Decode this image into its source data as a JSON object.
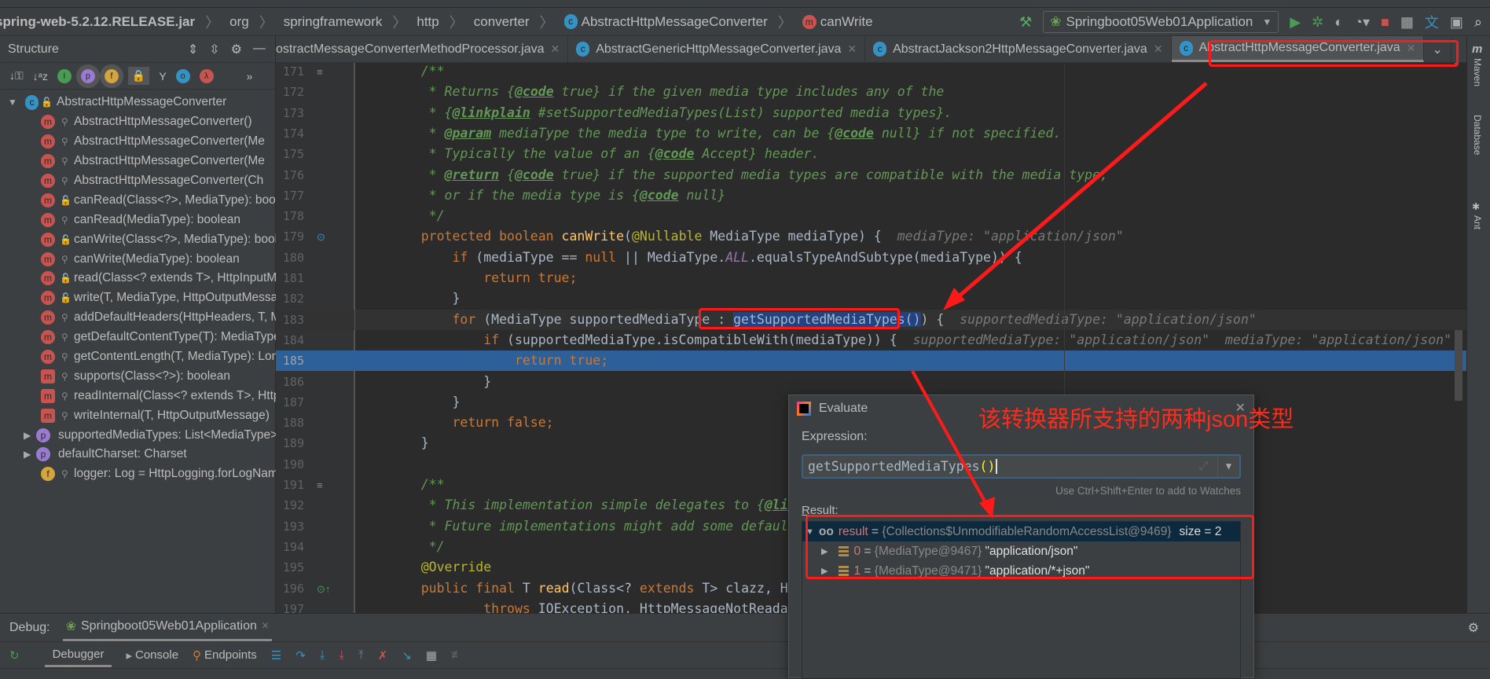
{
  "breadcrumb": [
    "spring-web-5.2.12.RELEASE.jar",
    "org",
    "springframework",
    "http",
    "converter",
    "AbstractHttpMessageConverter",
    "canWrite"
  ],
  "run_config": "Springboot05Web01Application",
  "structure": {
    "title": "Structure",
    "root": "AbstractHttpMessageConverter",
    "items": [
      {
        "icon": "method",
        "vis": "private",
        "label": "AbstractHttpMessageConverter()"
      },
      {
        "icon": "method",
        "vis": "private",
        "label": "AbstractHttpMessageConverter(Me"
      },
      {
        "icon": "method",
        "vis": "private",
        "label": "AbstractHttpMessageConverter(Me"
      },
      {
        "icon": "method",
        "vis": "private",
        "label": "AbstractHttpMessageConverter(Ch"
      },
      {
        "icon": "method",
        "vis": "public",
        "label": "canRead(Class<?>, MediaType): boolean"
      },
      {
        "icon": "method",
        "vis": "private",
        "label": "canRead(MediaType): boolean"
      },
      {
        "icon": "method",
        "vis": "public",
        "label": "canWrite(Class<?>, MediaType): boolean"
      },
      {
        "icon": "method",
        "vis": "private",
        "label": "canWrite(MediaType): boolean"
      },
      {
        "icon": "method",
        "vis": "public",
        "label": "read(Class<? extends T>, HttpInputMessage)"
      },
      {
        "icon": "method",
        "vis": "public",
        "label": "write(T, MediaType, HttpOutputMessage)"
      },
      {
        "icon": "method",
        "vis": "private",
        "label": "addDefaultHeaders(HttpHeaders, T, MediaType)"
      },
      {
        "icon": "method",
        "vis": "private",
        "label": "getDefaultContentType(T): MediaType"
      },
      {
        "icon": "method",
        "vis": "private",
        "label": "getContentLength(T, MediaType): Long"
      },
      {
        "icon": "abstract-method",
        "vis": "private",
        "label": "supports(Class<?>): boolean"
      },
      {
        "icon": "abstract-method",
        "vis": "private",
        "label": "readInternal(Class<? extends T>, HttpInputMessage)"
      },
      {
        "icon": "abstract-method",
        "vis": "private",
        "label": "writeInternal(T, HttpOutputMessage)"
      },
      {
        "icon": "property",
        "vis": "",
        "label": "supportedMediaTypes: List<MediaType>",
        "expandable": true
      },
      {
        "icon": "property",
        "vis": "",
        "label": "defaultCharset: Charset",
        "expandable": true
      },
      {
        "icon": "field",
        "vis": "private",
        "label": "logger: Log = HttpLogging.forLogName(getClass())"
      }
    ]
  },
  "tabs": [
    {
      "label": "ostractMessageConverterMethodProcessor.java",
      "active": false
    },
    {
      "label": "AbstractGenericHttpMessageConverter.java",
      "active": false
    },
    {
      "label": "AbstractJackson2HttpMessageConverter.java",
      "active": false
    },
    {
      "label": "AbstractHttpMessageConverter.java",
      "active": true
    }
  ],
  "right_tools": [
    "Maven",
    "Database",
    "Ant"
  ],
  "code": [
    {
      "n": "171",
      "t": [
        [
          "pl",
          "    "
        ],
        [
          "cm",
          "/**"
        ]
      ]
    },
    {
      "n": "172",
      "t": [
        [
          "cm",
          "     * Returns {"
        ],
        [
          "tag",
          "@code"
        ],
        [
          "cm",
          " true} if the given media type includes any of the"
        ]
      ]
    },
    {
      "n": "173",
      "t": [
        [
          "cm",
          "     * {"
        ],
        [
          "tag",
          "@linkplain"
        ],
        [
          "cm",
          " #setSupportedMediaTypes(List) supported media types}."
        ]
      ]
    },
    {
      "n": "174",
      "t": [
        [
          "cm",
          "     * "
        ],
        [
          "tag",
          "@param"
        ],
        [
          "cm",
          " mediaType the media type to write, can be {"
        ],
        [
          "tag",
          "@code"
        ],
        [
          "cm",
          " null} if not specified."
        ]
      ]
    },
    {
      "n": "175",
      "t": [
        [
          "cm",
          "     * Typically the value of an {"
        ],
        [
          "tag",
          "@code"
        ],
        [
          "cm",
          " Accept} header."
        ]
      ]
    },
    {
      "n": "176",
      "t": [
        [
          "cm",
          "     * "
        ],
        [
          "tag",
          "@return"
        ],
        [
          "cm",
          " {"
        ],
        [
          "tag",
          "@code"
        ],
        [
          "cm",
          " true} if the supported media types are compatible with the media type,"
        ]
      ]
    },
    {
      "n": "177",
      "t": [
        [
          "cm",
          "     * or if the media type is {"
        ],
        [
          "tag",
          "@code"
        ],
        [
          "cm",
          " null}"
        ]
      ]
    },
    {
      "n": "178",
      "t": [
        [
          "cm",
          "     */"
        ]
      ]
    },
    {
      "n": "179",
      "t": [
        [
          "kw",
          "    protected boolean "
        ],
        [
          "fn",
          "canWrite"
        ],
        [
          "pl",
          "("
        ],
        [
          "an",
          "@Nullable"
        ],
        [
          "pl",
          " MediaType mediaType) {  "
        ],
        [
          "hint",
          "mediaType: \"application/json\""
        ]
      ]
    },
    {
      "n": "180",
      "t": [
        [
          "kw",
          "        if "
        ],
        [
          "pl",
          "(mediaType == "
        ],
        [
          "kw",
          "null"
        ],
        [
          "pl",
          " || MediaType."
        ],
        [
          "st",
          "ALL"
        ],
        [
          "pl",
          ".equalsTypeAndSubtype(mediaType)) {"
        ]
      ]
    },
    {
      "n": "181",
      "t": [
        [
          "kw",
          "            return true"
        ],
        [
          "kw",
          ";"
        ]
      ]
    },
    {
      "n": "182",
      "t": [
        [
          "pl",
          "        }"
        ]
      ]
    },
    {
      "n": "183",
      "caret": true,
      "t": [
        [
          "kw",
          "        for "
        ],
        [
          "pl",
          "(MediaType supportedMediaType : "
        ],
        [
          "sel",
          "getSupportedMediaTypes()"
        ],
        [
          "pl",
          ") {  "
        ],
        [
          "hint",
          "supportedMediaType: \"application/json\""
        ]
      ]
    },
    {
      "n": "184",
      "t": [
        [
          "kw",
          "            if "
        ],
        [
          "pl",
          "(supportedMediaType.isCompatibleWith(mediaType)) {  "
        ],
        [
          "hint",
          "supportedMediaType: \"application/json\"  mediaType: \"application/json\""
        ]
      ]
    },
    {
      "n": "185",
      "exec": true,
      "t": [
        [
          "kw",
          "                return true;"
        ]
      ]
    },
    {
      "n": "186",
      "t": [
        [
          "pl",
          "            }"
        ]
      ]
    },
    {
      "n": "187",
      "t": [
        [
          "pl",
          "        }"
        ]
      ]
    },
    {
      "n": "188",
      "t": [
        [
          "kw",
          "        return false;"
        ]
      ]
    },
    {
      "n": "189",
      "t": [
        [
          "pl",
          "    }"
        ]
      ]
    },
    {
      "n": "190",
      "t": []
    },
    {
      "n": "191",
      "t": [
        [
          "cm",
          "    /**"
        ]
      ]
    },
    {
      "n": "192",
      "t": [
        [
          "cm",
          "     * This implementation simple delegates to {"
        ],
        [
          "tag",
          "@link"
        ],
        [
          "cm",
          " #readInternal(Class, HttpInputMessage)}."
        ]
      ]
    },
    {
      "n": "193",
      "t": [
        [
          "cm",
          "     * Future implementations might add some default behavior, however."
        ]
      ]
    },
    {
      "n": "194",
      "t": [
        [
          "cm",
          "     */"
        ]
      ]
    },
    {
      "n": "195",
      "t": [
        [
          "an",
          "    @Override"
        ]
      ]
    },
    {
      "n": "196",
      "t": [
        [
          "kw",
          "    public final "
        ],
        [
          "pl",
          "T "
        ],
        [
          "fn",
          "read"
        ],
        [
          "pl",
          "(Class<? "
        ],
        [
          "kw",
          "extends "
        ],
        [
          "pl",
          "T> clazz, HttpInputMessage inputMessage)"
        ]
      ]
    },
    {
      "n": "197",
      "t": [
        [
          "kw",
          "            throws "
        ],
        [
          "pl",
          "IOException, HttpMessageNotReadableException {"
        ]
      ]
    }
  ],
  "debug": {
    "label": "Debug:",
    "session": "Springboot05Web01Application",
    "tabs": [
      "Debugger",
      "Console",
      "Endpoints"
    ]
  },
  "evaluate": {
    "title": "Evaluate",
    "expression_label": "Expression:",
    "expression_value": "getSupportedMediaTypes",
    "expression_parens": "()",
    "watch_hint": "Use Ctrl+Shift+Enter to add to Watches",
    "result_label": "Result:",
    "result": {
      "name": "result",
      "type": "{Collections$UnmodifiableRandomAccessList@9469}",
      "size": "size = 2"
    },
    "items": [
      {
        "name": "0",
        "type": "{MediaType@9467}",
        "value": "\"application/json\""
      },
      {
        "name": "1",
        "type": "{MediaType@9471}",
        "value": "\"application/*+json\""
      }
    ]
  },
  "annotation": "该转换器所支持的两种json类型",
  "colors": {
    "annotation_red": "#ff1a1a",
    "editor_bg": "#2b2b2b",
    "exec_line": "#2d5f98",
    "keyword": "#cc7832",
    "comment": "#629755"
  }
}
